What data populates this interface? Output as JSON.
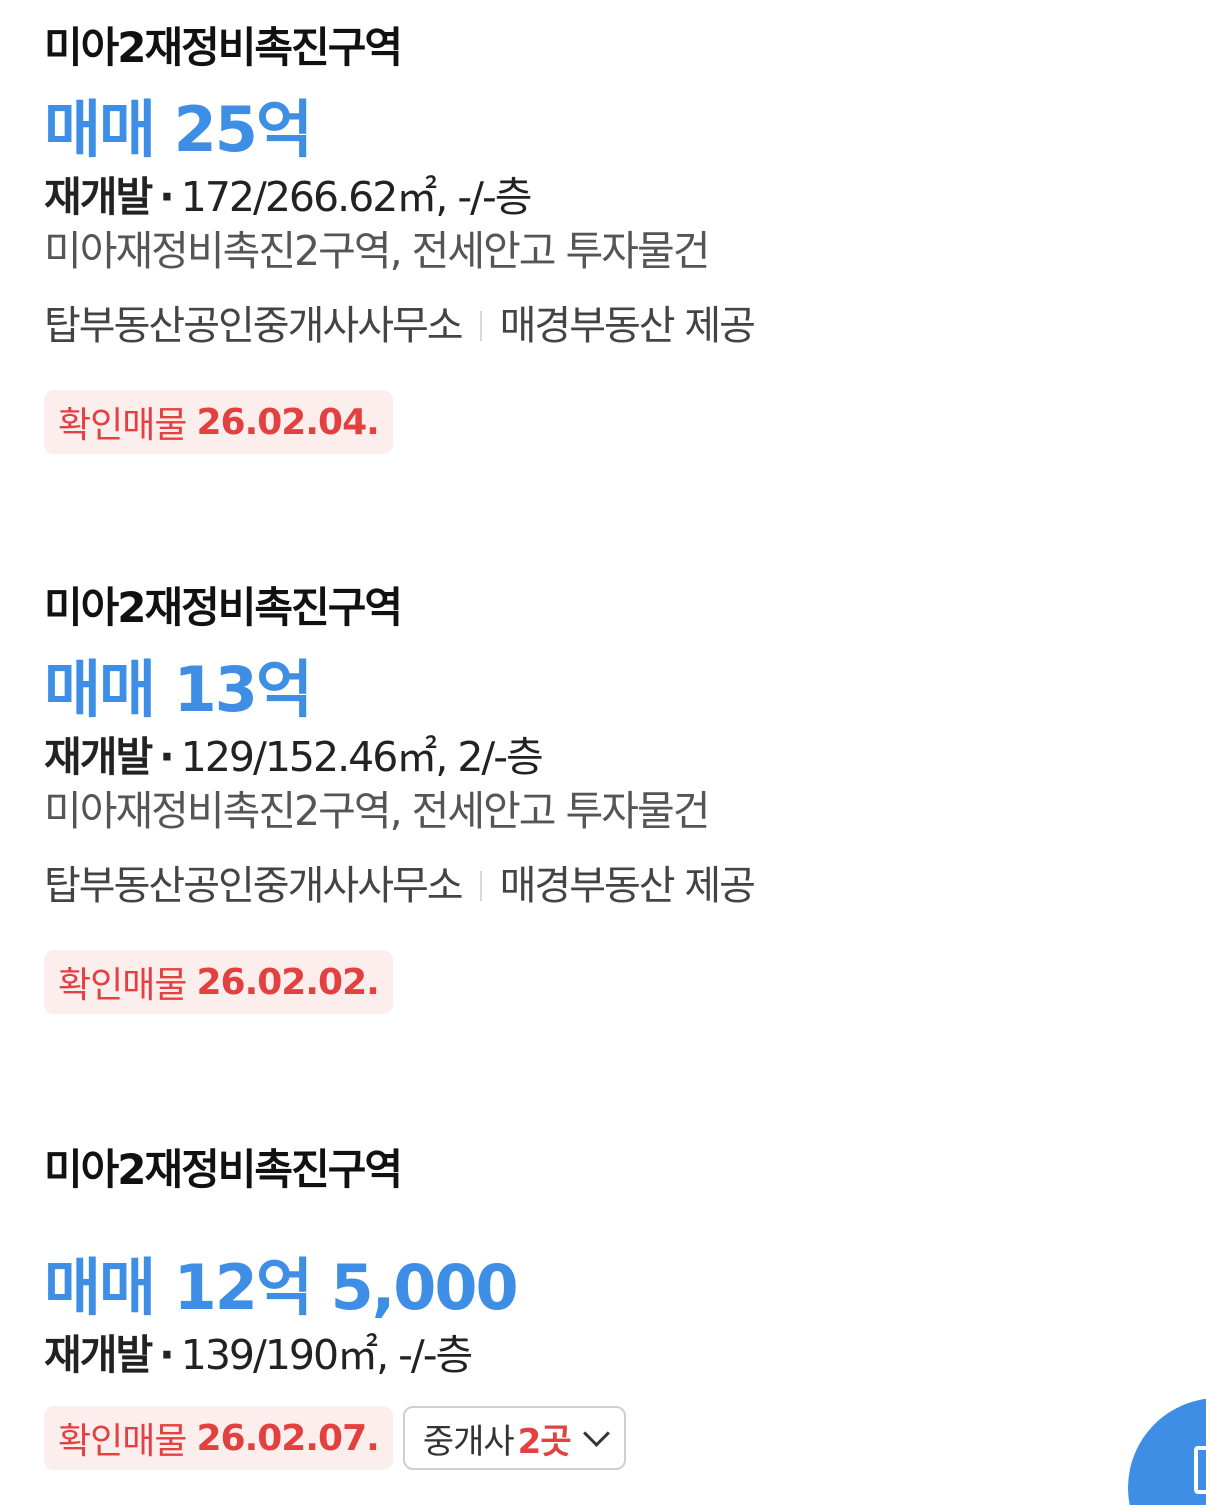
{
  "listings": [
    {
      "complex_name": "미아2재정비촉진구역",
      "price": "매매 25억",
      "spec_type": "재개발",
      "spec_detail": "172/266.62㎡, -/-층",
      "description": "미아재정비촉진2구역, 전세안고 투자물건",
      "agency": "탑부동산공인중개사사무소",
      "provider": "매경부동산 제공",
      "badge_label": "확인매물",
      "badge_date": "26.02.04."
    },
    {
      "complex_name": "미아2재정비촉진구역",
      "price": "매매 13억",
      "spec_type": "재개발",
      "spec_detail": "129/152.46㎡, 2/-층",
      "description": "미아재정비촉진2구역, 전세안고 투자물건",
      "agency": "탑부동산공인중개사사무소",
      "provider": "매경부동산 제공",
      "badge_label": "확인매물",
      "badge_date": "26.02.02."
    },
    {
      "complex_name": "미아2재정비촉진구역",
      "price": "매매 12억 5,000",
      "spec_type": "재개발",
      "spec_detail": "139/190㎡, -/-층",
      "badge_label": "확인매물",
      "badge_date": "26.02.07.",
      "broker_label": "중개사",
      "broker_count": "2곳"
    }
  ],
  "spec_separator": "·",
  "colors": {
    "price": "#3f8ee6",
    "badge_text": "#e34040",
    "badge_bg": "#fdeeee",
    "fab": "#3f8ee6"
  },
  "icons": {
    "broker_toggle": "chevron-down-icon",
    "fab": "map-icon"
  }
}
